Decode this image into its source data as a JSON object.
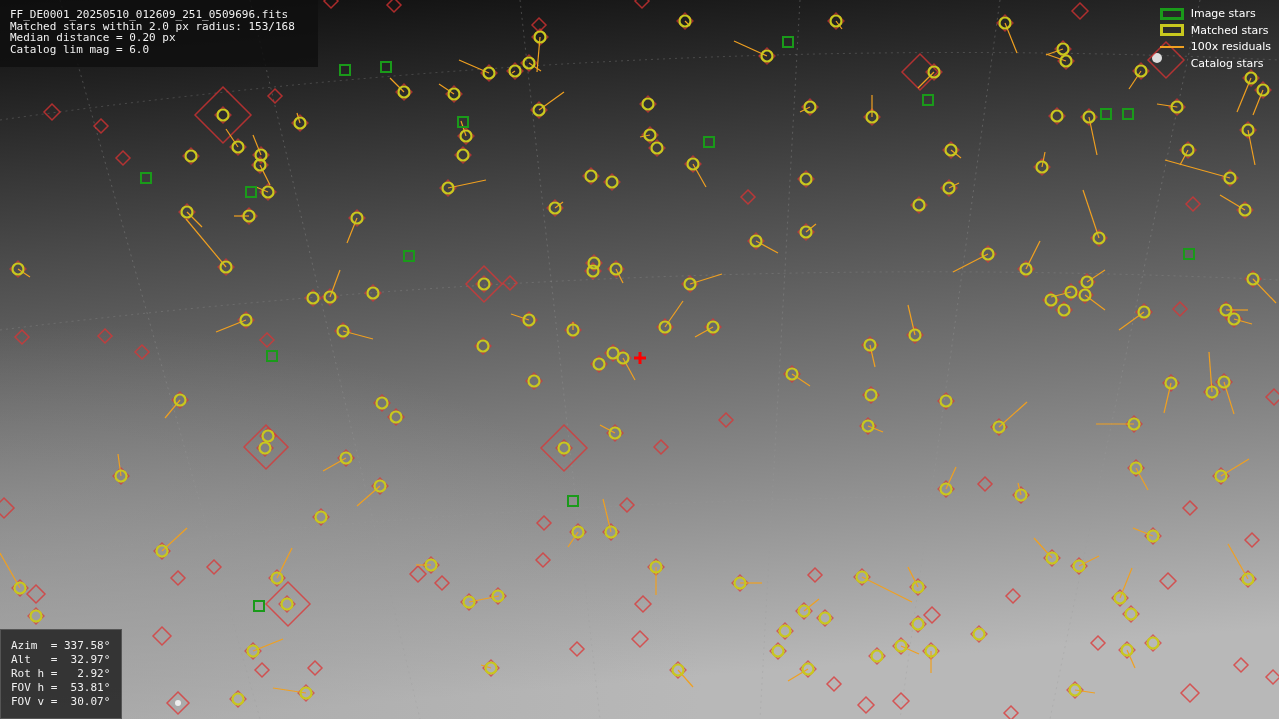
{
  "info_box": {
    "lines": [
      "FF_DE0001_20250510_012609_251_0509696.fits",
      "Matched stars within 2.0 px radius: 153/168",
      "Median distance = 0.20 px",
      "Catalog lim mag = 6.0"
    ]
  },
  "legend": [
    {
      "label": "Image stars",
      "kind": "box",
      "color": "#1a9a1a"
    },
    {
      "label": "Matched stars",
      "kind": "box",
      "color": "#c8c81e"
    },
    {
      "label": "100x residuals",
      "kind": "line",
      "color": "#f0a020"
    },
    {
      "label": "Catalog stars",
      "kind": "hidden"
    }
  ],
  "pointing_box": {
    "lines": [
      "Azim  = 337.58°",
      "Alt   =  32.97°",
      "Rot h =   2.92°",
      "FOV h =  53.81°",
      "FOV v =  30.07°"
    ]
  }
}
